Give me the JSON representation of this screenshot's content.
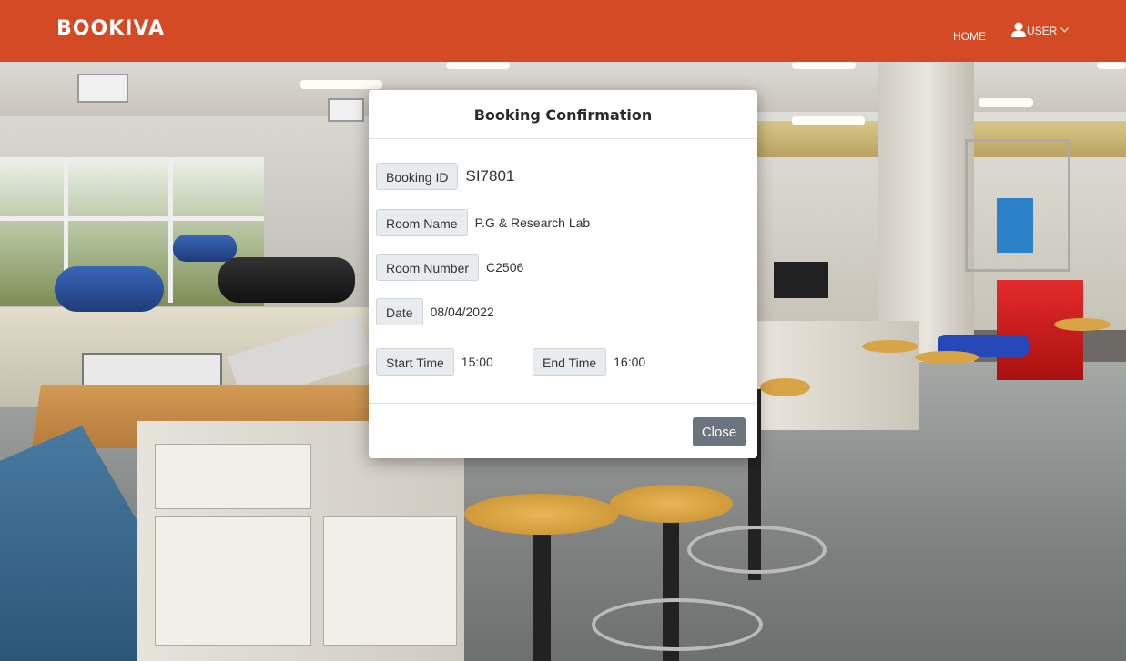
{
  "navbar": {
    "brand": "BOOKIVA",
    "home_label": "HOME",
    "user_label": "USER",
    "color": "#d44a25"
  },
  "modal": {
    "title": "Booking Confirmation",
    "fields": {
      "booking_id": {
        "label": "Booking ID",
        "value": "SI7801"
      },
      "room_name": {
        "label": "Room Name",
        "value": "P.G & Research Lab"
      },
      "room_number": {
        "label": "Room Number",
        "value": "C2506"
      },
      "date": {
        "label": "Date",
        "value": "08/04/2022"
      },
      "start_time": {
        "label": "Start Time",
        "value": "15:00"
      },
      "end_time": {
        "label": "End Time",
        "value": "16:00"
      }
    },
    "close_label": "Close"
  },
  "icons": {
    "user": "user-icon",
    "chevron": "chevron-down-icon"
  }
}
